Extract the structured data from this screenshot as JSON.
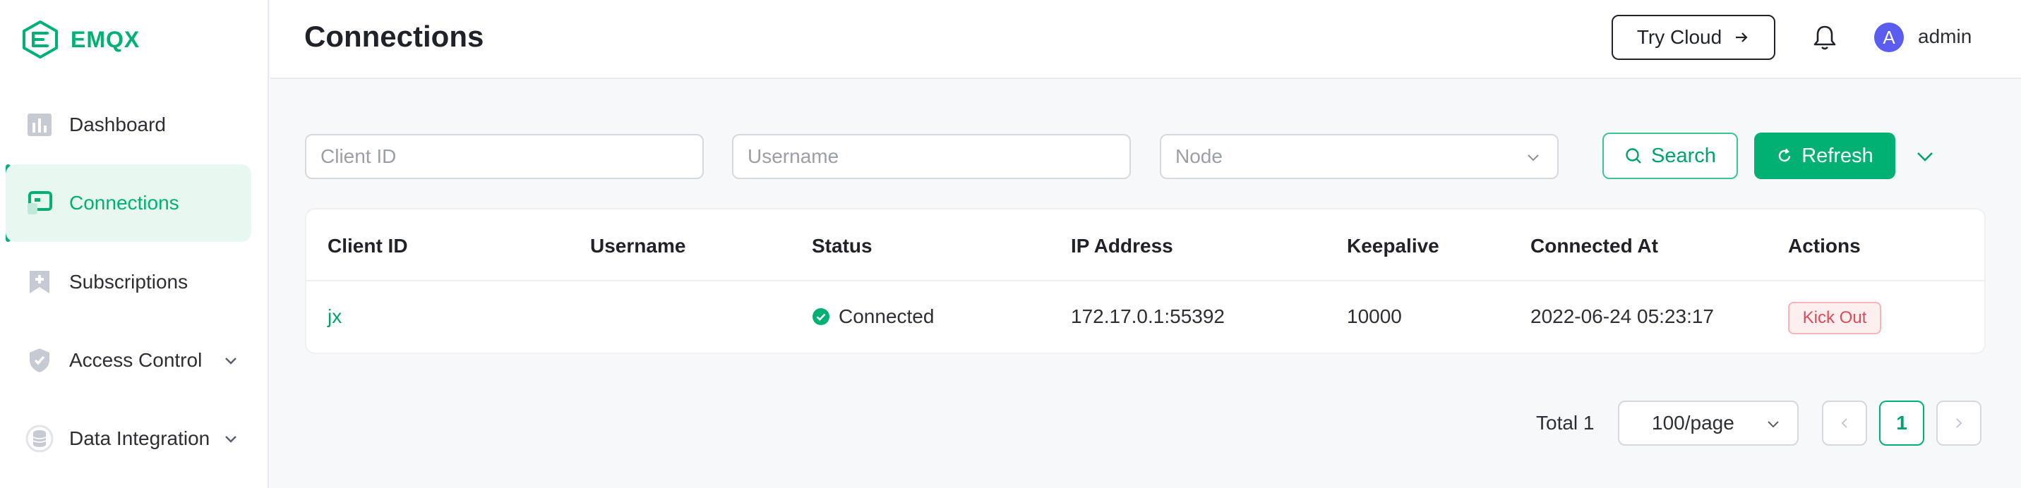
{
  "brand": {
    "name": "EMQX",
    "logo_icon": "emqx-logo-icon"
  },
  "sidebar": {
    "items": [
      {
        "label": "Dashboard",
        "icon": "dashboard-icon",
        "active": false,
        "has_submenu": false
      },
      {
        "label": "Connections",
        "icon": "connections-icon",
        "active": true,
        "has_submenu": false
      },
      {
        "label": "Subscriptions",
        "icon": "subscriptions-icon",
        "active": false,
        "has_submenu": false
      },
      {
        "label": "Access Control",
        "icon": "shield-icon",
        "active": false,
        "has_submenu": true
      },
      {
        "label": "Data Integration",
        "icon": "database-icon",
        "active": false,
        "has_submenu": true
      }
    ]
  },
  "header": {
    "title": "Connections",
    "try_cloud_label": "Try Cloud",
    "avatar_letter": "A",
    "username": "admin"
  },
  "filters": {
    "client_id_placeholder": "Client ID",
    "username_placeholder": "Username",
    "node_placeholder": "Node",
    "search_label": "Search",
    "refresh_label": "Refresh"
  },
  "table": {
    "columns": [
      "Client ID",
      "Username",
      "Status",
      "IP Address",
      "Keepalive",
      "Connected At",
      "Actions"
    ],
    "rows": [
      {
        "client_id": "jx",
        "username": "",
        "status": "Connected",
        "ip_address": "172.17.0.1:55392",
        "keepalive": "10000",
        "connected_at": "2022-06-24 05:23:17",
        "action": "Kick Out"
      }
    ]
  },
  "pagination": {
    "total_label": "Total 1",
    "page_size": "100/page",
    "current_page": "1"
  },
  "colors": {
    "accent": "#00b173",
    "danger": "#e04a57",
    "avatar": "#5b5cf0"
  }
}
